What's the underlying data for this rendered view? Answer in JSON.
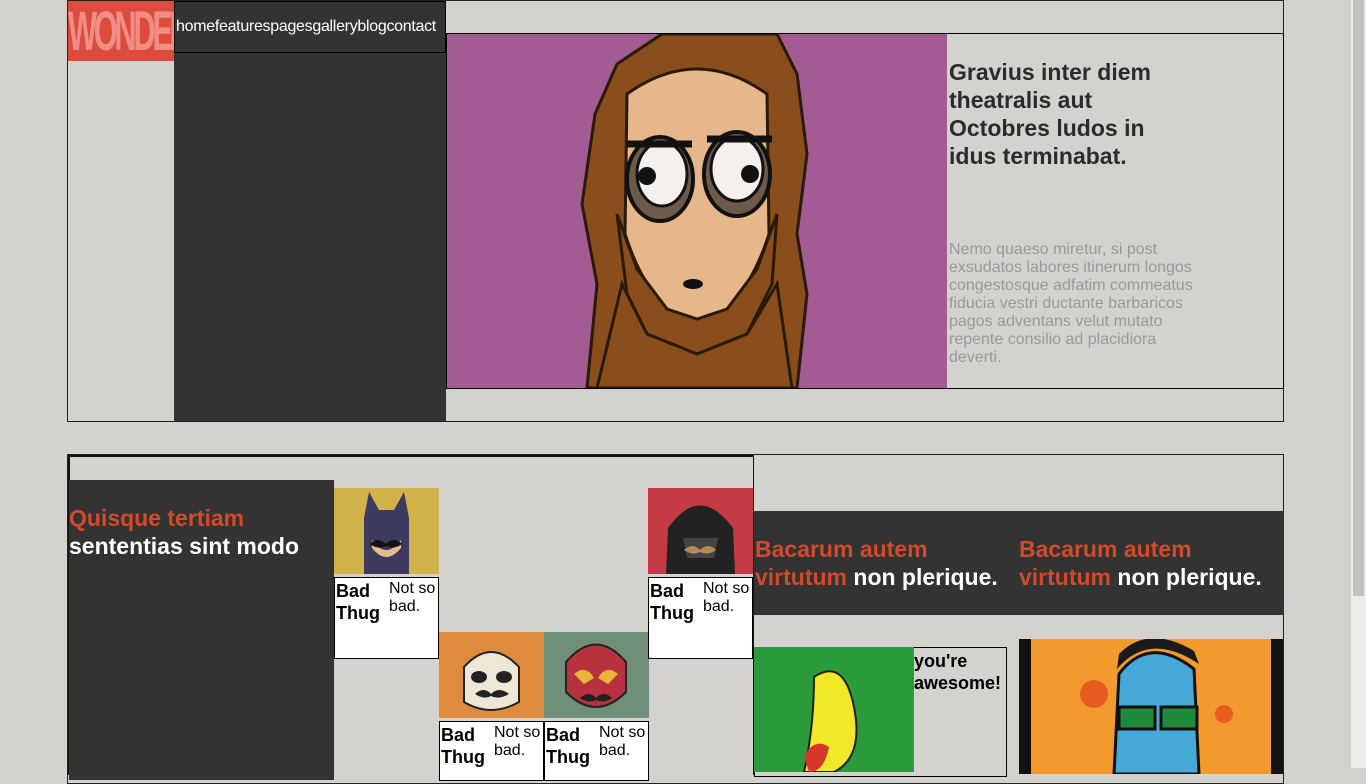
{
  "logo": {
    "text": "WONDER",
    "color": "#db4c3f"
  },
  "nav": {
    "items": [
      "home",
      "features",
      "pages",
      "gallery",
      "blog",
      "contact"
    ]
  },
  "hero": {
    "image_icon": "bigfoot-illustration",
    "title": "Gravius inter diem theatralis aut Octobres ludos in idus terminabat.",
    "text": "Nemo quaeso miretur, si post exsudatos labores itinerum longos congestosque adfatim commeatus fiducia vestri ductante barbaricos pagos adventans velut mutato repente consilio ad placidiora deverti."
  },
  "quote": {
    "orange": "Quisque tertiam",
    "white": "sententias sint modo"
  },
  "cards": [
    {
      "icon": "batman-mustache-icon",
      "title": "Bad Thug",
      "subtitle": "Not so bad.",
      "bg": "#d1b34a"
    },
    {
      "icon": "stormtrooper-mustache-icon",
      "title": "Bad Thug",
      "subtitle": "Not so bad.",
      "bg": "#e08a3d"
    },
    {
      "icon": "luchador-mask-icon",
      "title": "Bad Thug",
      "subtitle": "Not so bad.",
      "bg": "#6f8f78"
    },
    {
      "icon": "vader-mustache-icon",
      "title": "Bad Thug",
      "subtitle": "Not so bad.",
      "bg": "#c43a45"
    }
  ],
  "band": [
    {
      "orange": "Bacarum autem virtutum",
      "white": "non plerique."
    },
    {
      "orange": "Bacarum autem virtutum",
      "white": "non plerique."
    }
  ],
  "awesome": {
    "text": "you're awesome!",
    "image_icon": "parrot-illustration"
  },
  "pop_image": {
    "icon": "sunglasses-man-illustration"
  },
  "colors": {
    "accent": "#d24a2a",
    "dark": "#333333",
    "background": "#d3d2ce"
  }
}
